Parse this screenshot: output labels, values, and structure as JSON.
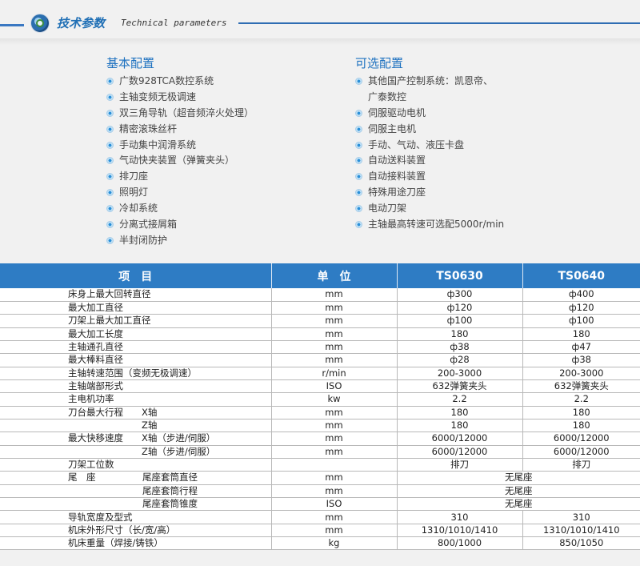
{
  "header": {
    "title_cn": "技术参数",
    "title_en": "Technical parameters"
  },
  "basic": {
    "title": "基本配置",
    "items": [
      "广数928TCA数控系统",
      "主轴变频无极调速",
      "双三角导轨（超音频淬火处理）",
      "精密滚珠丝杆",
      "手动集中润滑系统",
      "气动快夹装置（弹簧夹头）",
      "排刀座",
      "照明灯",
      "冷却系统",
      "分离式接屑箱",
      "半封闭防护"
    ]
  },
  "optional": {
    "title": "可选配置",
    "items": [
      "其他国产控制系统：凯恩帝、",
      "广泰数控",
      "伺服驱动电机",
      "伺服主电机",
      "手动、气动、液压卡盘",
      "自动送料装置",
      "自动接料装置",
      "特殊用途刀座",
      "电动刀架",
      "主轴最高转速可选配5000r/min"
    ]
  },
  "table": {
    "headers": [
      "项　目",
      "单　位",
      "TS0630",
      "TS0640"
    ],
    "rows": [
      {
        "item": "床身上最大回转直径",
        "sub": "",
        "unit": "mm",
        "a": "ф300",
        "b": "ф400"
      },
      {
        "item": "最大加工直径",
        "sub": "",
        "unit": "mm",
        "a": "ф120",
        "b": "ф120"
      },
      {
        "item": "刀架上最大加工直径",
        "sub": "",
        "unit": "mm",
        "a": "ф100",
        "b": "ф100"
      },
      {
        "item": "最大加工长度",
        "sub": "",
        "unit": "mm",
        "a": "180",
        "b": "180"
      },
      {
        "item": "主轴通孔直径",
        "sub": "",
        "unit": "mm",
        "a": "ф38",
        "b": "ф47"
      },
      {
        "item": "最大棒料直径",
        "sub": "",
        "unit": "mm",
        "a": "ф28",
        "b": "ф38"
      },
      {
        "item": "主轴转速范围（变频无极调速）",
        "sub": "",
        "unit": "r/min",
        "a": "200-3000",
        "b": "200-3000"
      },
      {
        "item": "主轴端部形式",
        "sub": "",
        "unit": "ISO",
        "a": "632弹簧夹头",
        "b": "632弹簧夹头"
      },
      {
        "item": "主电机功率",
        "sub": "",
        "unit": "kw",
        "a": "2.2",
        "b": "2.2"
      },
      {
        "item": "刀台最大行程",
        "sub": "X轴",
        "unit": "mm",
        "a": "180",
        "b": "180"
      },
      {
        "item": "",
        "sub": "Z轴",
        "unit": "mm",
        "a": "180",
        "b": "180"
      },
      {
        "item": "最大快移速度",
        "sub": "X轴（步进/伺服）",
        "unit": "mm",
        "a": "6000/12000",
        "b": "6000/12000"
      },
      {
        "item": "",
        "sub": "Z轴（步进/伺服）",
        "unit": "mm",
        "a": "6000/12000",
        "b": "6000/12000"
      },
      {
        "item": "刀架工位数",
        "sub": "",
        "unit": "",
        "a": "排刀",
        "b": "排刀"
      },
      {
        "item": "尾　座",
        "sub": "尾座套筒直径",
        "unit": "mm",
        "merged": "无尾座"
      },
      {
        "item": "",
        "sub": "尾座套筒行程",
        "unit": "mm",
        "merged": "无尾座"
      },
      {
        "item": "",
        "sub": "尾座套筒锥度",
        "unit": "ISO",
        "merged": "无尾座"
      },
      {
        "item": "导轨宽度及型式",
        "sub": "",
        "unit": "mm",
        "a": "310",
        "b": "310"
      },
      {
        "item": "机床外形尺寸（长/宽/高）",
        "sub": "",
        "unit": "mm",
        "a": "1310/1010/1410",
        "b": "1310/1010/1410"
      },
      {
        "item": "机床重量（焊接/铸铁）",
        "sub": "",
        "unit": "kg",
        "a": "800/1000",
        "b": "850/1050"
      }
    ]
  }
}
